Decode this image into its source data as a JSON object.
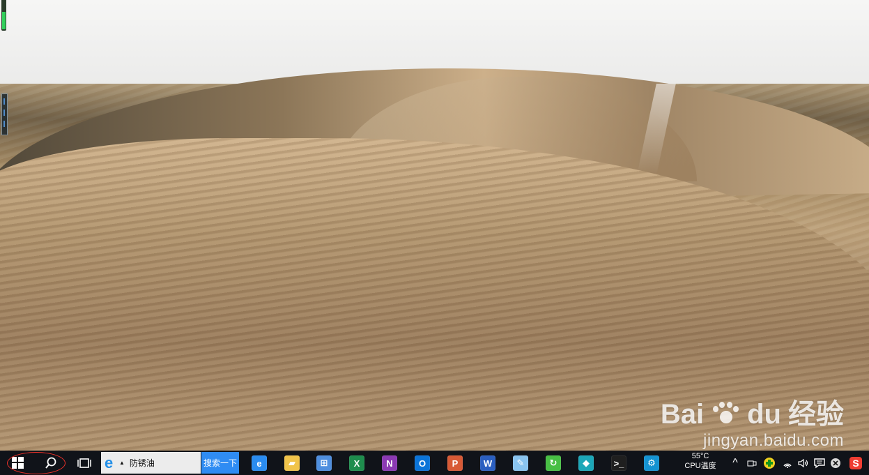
{
  "desktop": {
    "wallpaper": "desert sand dunes",
    "cpu_gauge_level": 0.62,
    "watermark": {
      "brand_left": "Bai",
      "brand_mid": "du",
      "brand_right": "经验",
      "url": "jingyan.baidu.com"
    }
  },
  "taskbar": {
    "start_icon": "windows-logo",
    "search_icon": "magnifier",
    "task_view_icon": "task-view",
    "search_field": {
      "value": "防锈油",
      "placeholder": ""
    },
    "search_button_label": "搜索一下",
    "apps": [
      {
        "name": "edge",
        "label": "e",
        "color": "#2a8cf0"
      },
      {
        "name": "file-explorer",
        "label": "▰",
        "color": "#f1c44a"
      },
      {
        "name": "store",
        "label": "⊞",
        "color": "#4f8fdf"
      },
      {
        "name": "excel",
        "label": "X",
        "color": "#1e8d4d"
      },
      {
        "name": "onenote",
        "label": "N",
        "color": "#8b39b3"
      },
      {
        "name": "outlook",
        "label": "O",
        "color": "#0b74d8"
      },
      {
        "name": "powerpoint",
        "label": "P",
        "color": "#d85a36"
      },
      {
        "name": "word",
        "label": "W",
        "color": "#2b5fc0"
      },
      {
        "name": "paint",
        "label": "✎",
        "color": "#8ac4ef"
      },
      {
        "name": "green-refresh",
        "label": "↻",
        "color": "#48bf44"
      },
      {
        "name": "maps",
        "label": "◆",
        "color": "#1ca7b8"
      },
      {
        "name": "cmd",
        "label": ">_",
        "color": "#1f1f1f"
      },
      {
        "name": "settings",
        "label": "⚙",
        "color": "#1593d2"
      }
    ],
    "cpu_temp": "55°C",
    "cpu_label": "CPU温度",
    "tray": {
      "chevron": "^",
      "message": "💬",
      "sogou": "S"
    }
  }
}
